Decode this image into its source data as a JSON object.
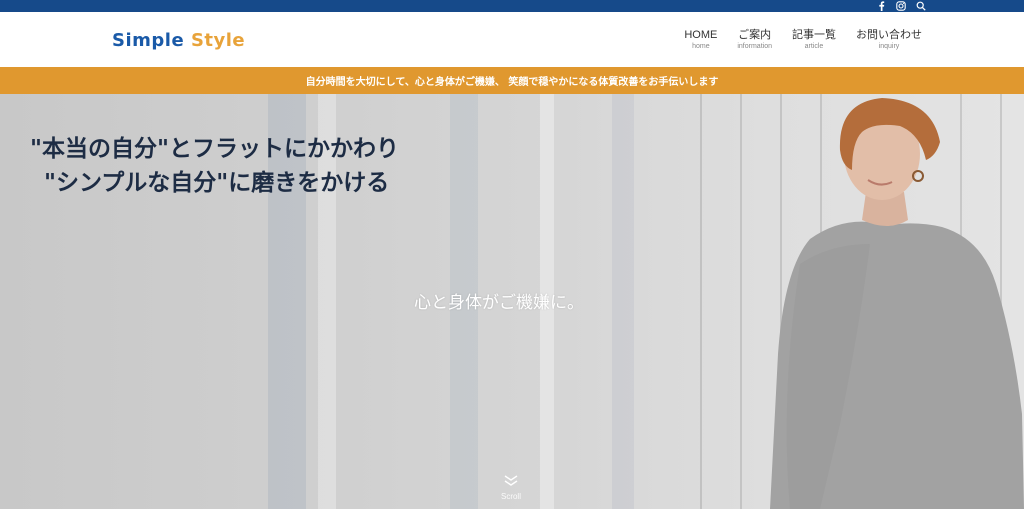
{
  "topbar": {
    "icons": [
      "facebook-icon",
      "instagram-icon",
      "search-icon"
    ],
    "color": "#164a8a"
  },
  "header": {
    "logo_part1": "Simple",
    "logo_part2": "Style",
    "logo_colors": {
      "part1": "#1a5aa8",
      "part2": "#e8a33a"
    },
    "nav": [
      {
        "label": "HOME",
        "sub": "home"
      },
      {
        "label": "ご案内",
        "sub": "information"
      },
      {
        "label": "記事一覧",
        "sub": "article"
      },
      {
        "label": "お問い合わせ",
        "sub": "inquiry"
      }
    ]
  },
  "tagline": {
    "text": "自分時間を大切にして、心と身体がご機嫌、 笑顔で穏やかになる体質改善をお手伝いします",
    "bg_color": "#e0982f"
  },
  "hero": {
    "headline_line1": "\"本当の自分\"とフラットにかかわり",
    "headline_line2": "\"シンプルな自分\"に磨きをかける",
    "subcopy": "心と身体がご機嫌に。",
    "scroll_label": "Scroll"
  }
}
